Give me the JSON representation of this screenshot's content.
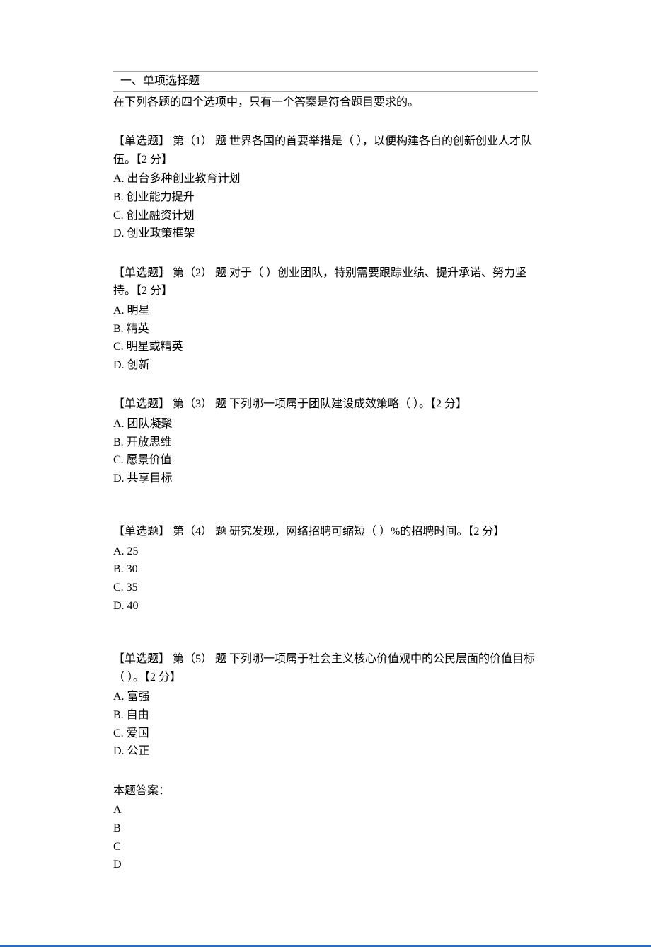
{
  "section": {
    "title": "一、单项选择题",
    "instruction": "在下列各题的四个选项中，只有一个答案是符合题目要求的。"
  },
  "questions": [
    {
      "prompt": "【单选题】 第（1）  题  世界各国的首要举措是（ ），以便构建各自的创新创业人才队伍。【2 分】",
      "options": [
        "A.  出台多种创业教育计划",
        "B.  创业能力提升",
        "C.  创业融资计划",
        "D.  创业政策框架"
      ]
    },
    {
      "prompt": "【单选题】 第（2）  题  对于（ ）创业团队，特别需要跟踪业绩、提升承诺、努力坚持。【2 分】",
      "options": [
        "A.  明星",
        "B.  精英",
        "C.  明星或精英",
        "D.  创新"
      ]
    },
    {
      "prompt": "【单选题】 第（3）  题  下列哪一项属于团队建设成效策略（  ）。【2 分】",
      "options": [
        "A.  团队凝聚",
        "B.  开放思维",
        "C.  愿景价值",
        "D.  共享目标"
      ]
    },
    {
      "prompt": "【单选题】 第（4）  题  研究发现，网络招聘可缩短（  ）%的招聘时间。【2 分】",
      "options": [
        "A. 25",
        "B. 30",
        "C. 35",
        "D. 40"
      ]
    },
    {
      "prompt": "【单选题】 第（5）  题  下列哪一项属于社会主义核心价值观中的公民层面的价值目标（ ）。【2 分】",
      "options": [
        "A.  富强",
        "B.  自由",
        "C.  爱国",
        "D.  公正"
      ]
    }
  ],
  "answers": {
    "title": "本题答案：",
    "lines": [
      "A",
      "B",
      "C",
      "D"
    ]
  }
}
